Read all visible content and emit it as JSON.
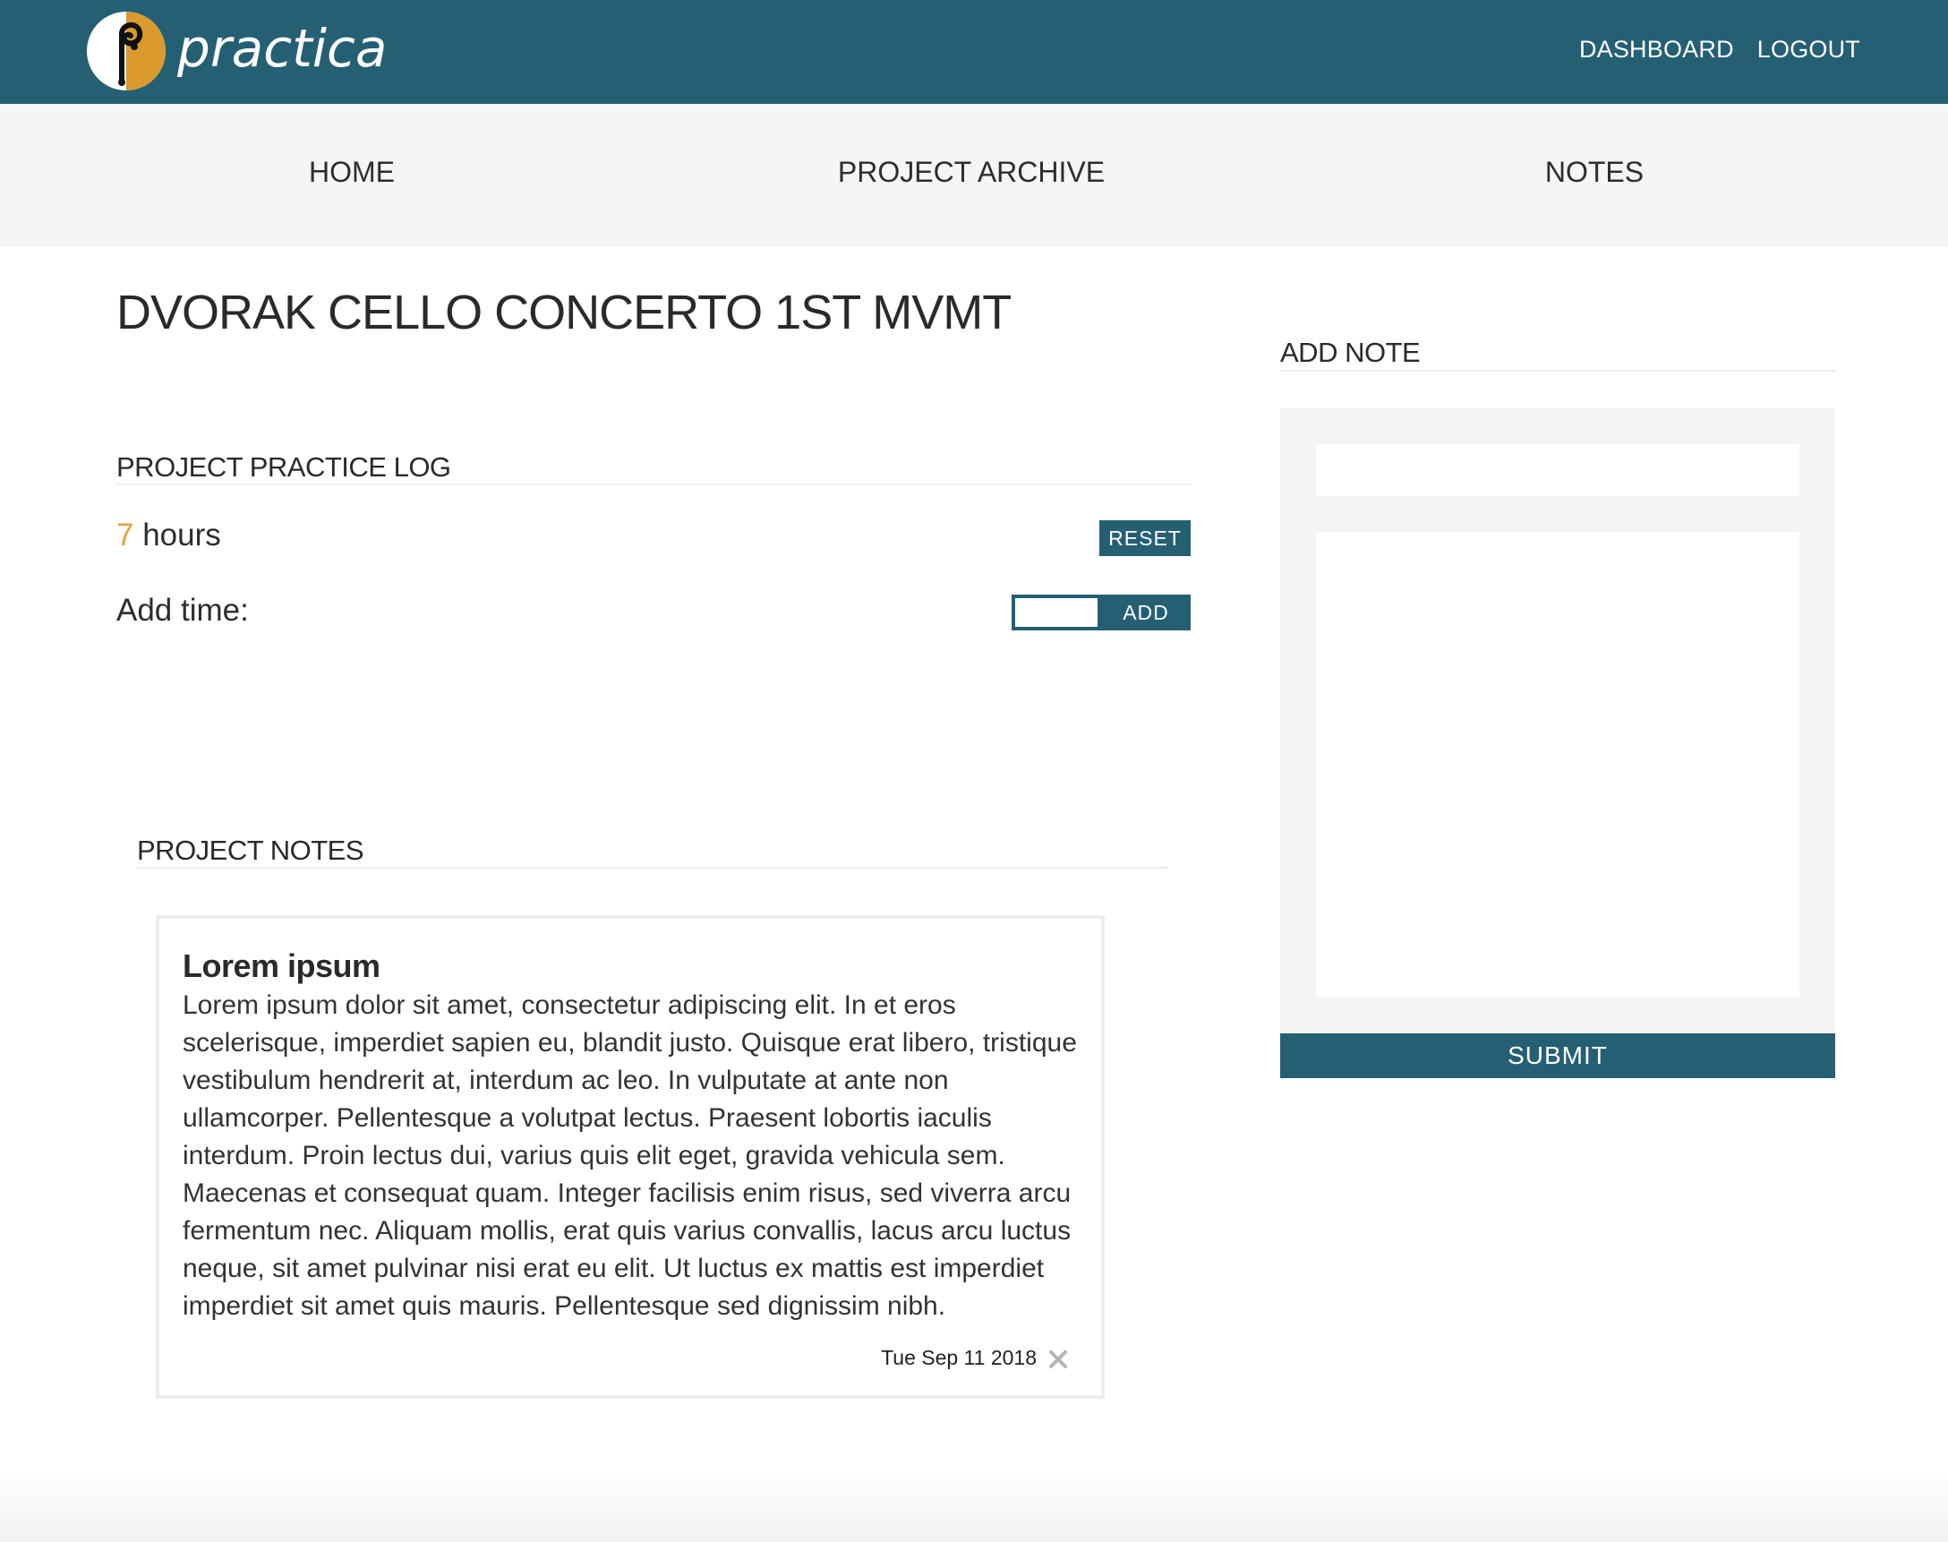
{
  "header": {
    "brand": "practica",
    "logo_icon": "treble-clef-logo-icon",
    "nav": [
      {
        "label": "DASHBOARD"
      },
      {
        "label": "LOGOUT"
      }
    ]
  },
  "subnav": {
    "items": [
      {
        "label": "HOME"
      },
      {
        "label": "PROJECT ARCHIVE"
      },
      {
        "label": "NOTES"
      }
    ]
  },
  "project": {
    "title": "DVORAK CELLO CONCERTO 1ST MVMT"
  },
  "practice_log": {
    "heading": "PROJECT PRACTICE LOG",
    "hours_value": "7",
    "hours_unit": "hours",
    "reset_label": "RESET",
    "add_time_label": "Add time:",
    "add_time_value": "",
    "add_label": "ADD"
  },
  "project_notes": {
    "heading": "PROJECT NOTES",
    "notes": [
      {
        "title": "Lorem ipsum",
        "body": "Lorem ipsum dolor sit amet, consectetur adipiscing elit. In et eros scelerisque, imperdiet sapien eu, blandit justo. Quisque erat libero, tristique vestibulum hendrerit at, interdum ac leo. In vulputate at ante non ullamcorper. Pellentesque a volutpat lectus. Praesent lobortis iaculis interdum. Proin lectus dui, varius quis elit eget, gravida vehicula sem. Maecenas et consequat quam. Integer facilisis enim risus, sed viverra arcu fermentum nec. Aliquam mollis, erat quis varius convallis, lacus arcu luctus neque, sit amet pulvinar nisi erat eu elit. Ut luctus ex mattis est imperdiet imperdiet sit amet quis mauris. Pellentesque sed dignissim nibh.",
        "date": "Tue Sep 11 2018",
        "delete_icon": "close-icon"
      }
    ]
  },
  "add_note": {
    "heading": "ADD NOTE",
    "title_value": "",
    "body_value": "",
    "submit_label": "SUBMIT"
  },
  "colors": {
    "primary": "#255f73",
    "accent": "#e8a23a",
    "panel_bg": "#f4f4f4",
    "subnav_bg": "#f5f5f5"
  }
}
